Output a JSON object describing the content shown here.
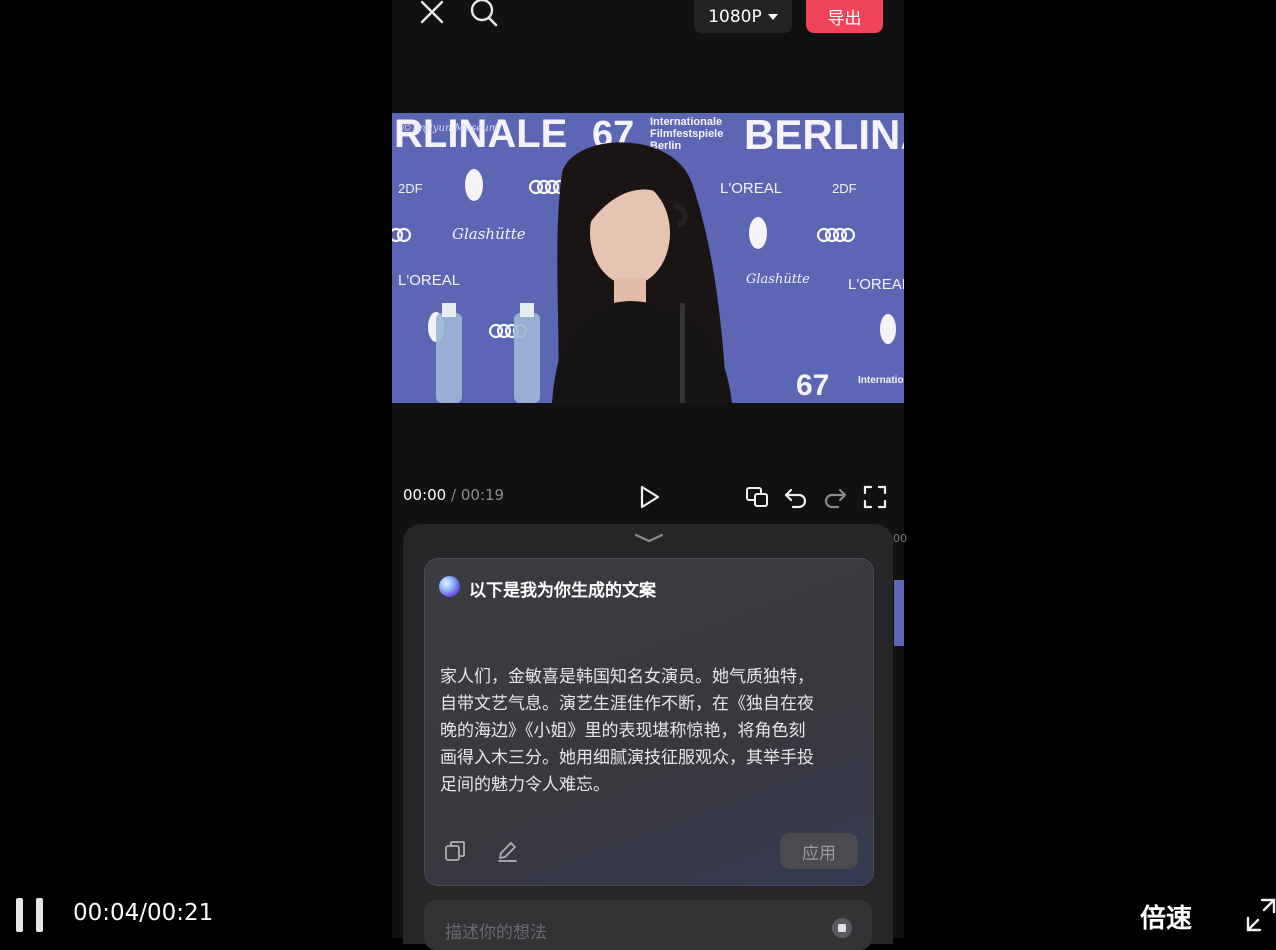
{
  "editor": {
    "resolution": "1080P",
    "export_label": "导出",
    "current_time": "00:00",
    "separator": "/",
    "total_time": "00:19"
  },
  "video_frame": {
    "backdrop_texts": [
      "RLINALE",
      "67",
      "Internationale",
      "Filmfestspiele",
      "Berlin",
      "BERLINA",
      "L'OREAL",
      "2DF",
      "Glashütte",
      "©JinJiyun Museum"
    ]
  },
  "ai_card": {
    "title": "以下是我为你生成的文案",
    "body": "家人们，金敏喜是韩国知名女演员。她气质独特，\n自带文艺气息。演艺生涯佳作不断，在《独自在夜\n晚的海边》《小姐》里的表现堪称惊艳，将角色刻\n画得入木三分。她用细腻演技征服观众，其举手投\n足间的魅力令人难忘。",
    "apply_label": "应用"
  },
  "prompt_input": {
    "placeholder": "描述你的想法"
  },
  "timeline_peek": {
    "time_fragment": "00"
  },
  "player": {
    "time": "00:04/00:21",
    "speed_label": "倍速"
  },
  "colors": {
    "export_button": "#f0435a",
    "backdrop_blue": "#5d67b5"
  }
}
